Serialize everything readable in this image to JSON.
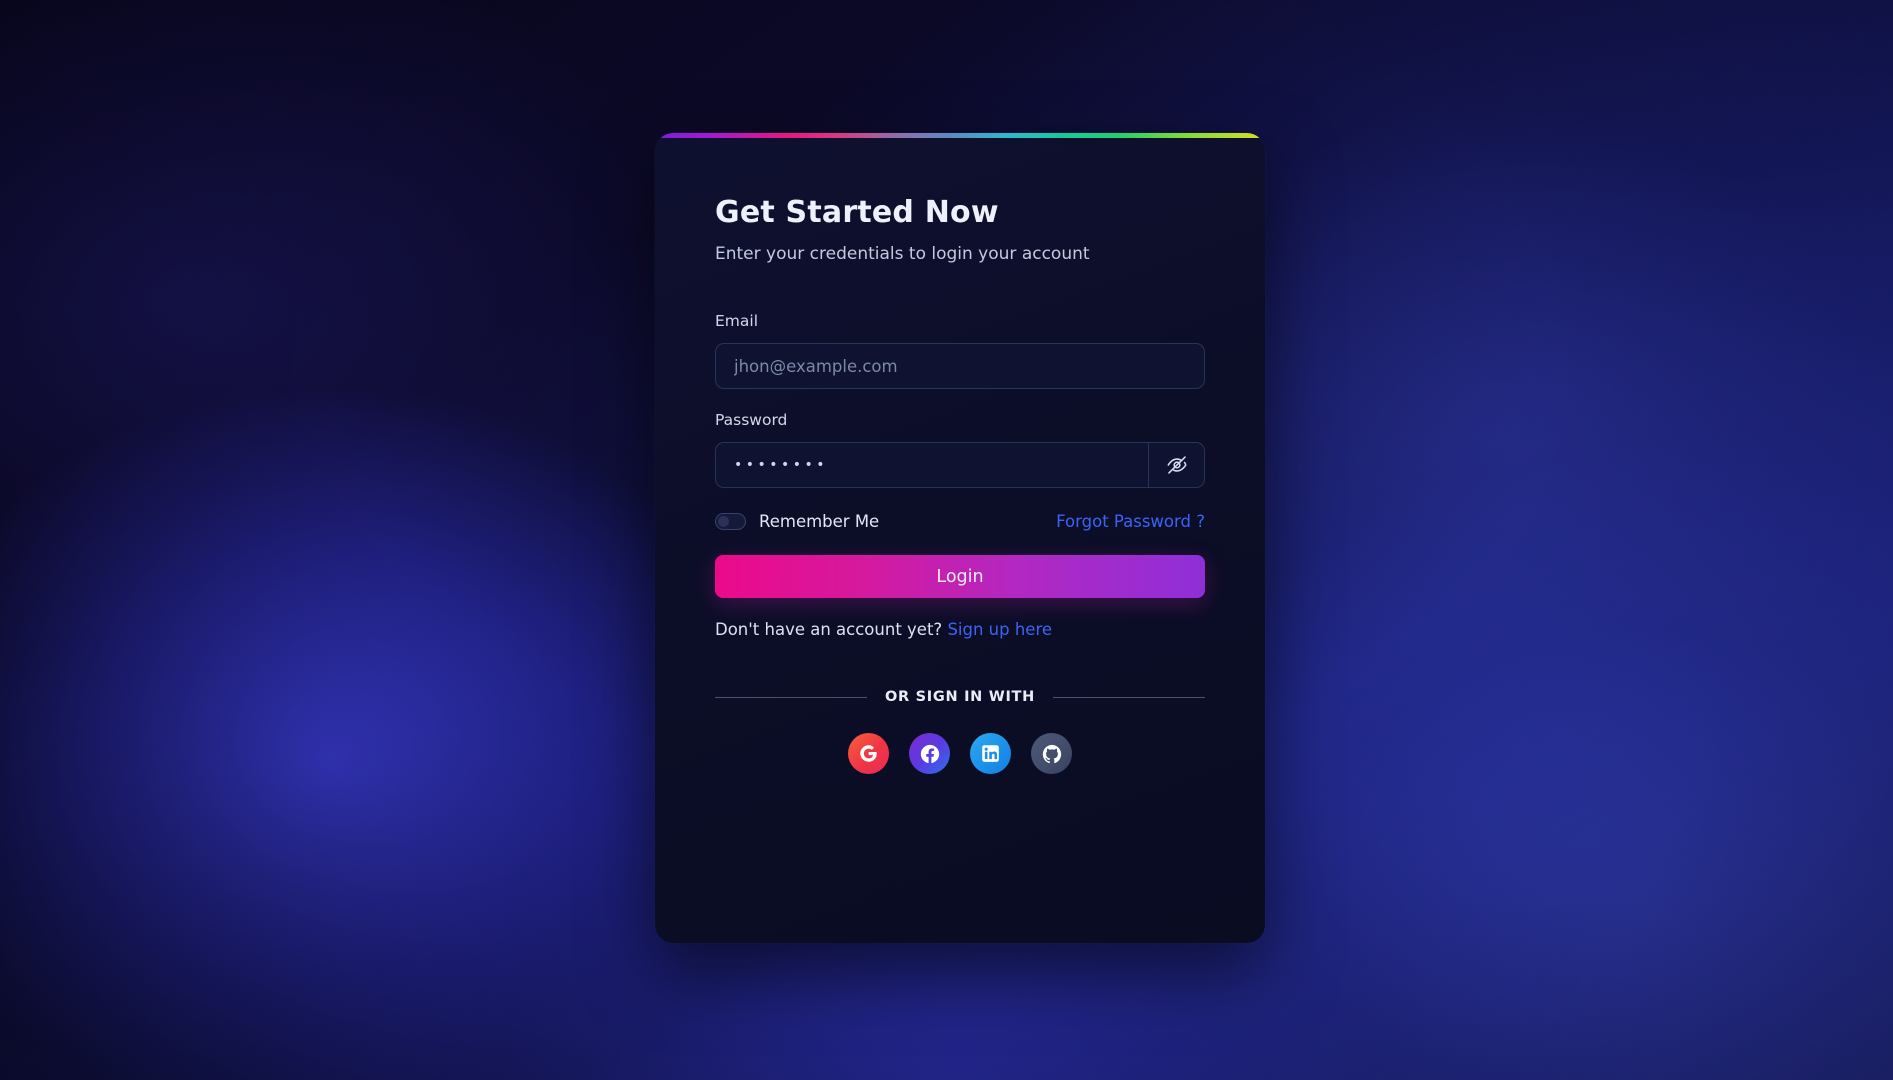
{
  "background": {
    "base_color": "#0a0820",
    "glow_left": "#2a2bb0",
    "glow_right": "#2e3a9e"
  },
  "card": {
    "background_color": "#0c0e28",
    "accent_bar": {
      "name": "rainbow-gradient-bar",
      "stops": [
        "#7b1fd6",
        "#e8177f",
        "#5f87c4",
        "#18c9a0",
        "#7ad93c",
        "#d6e024"
      ]
    },
    "heading": "Get Started Now",
    "subheading": "Enter your credentials to login your account"
  },
  "form": {
    "email": {
      "label": "Email",
      "placeholder": "jhon@example.com",
      "value": ""
    },
    "password": {
      "label": "Password",
      "value": "••••••••",
      "masked_char_count": 8,
      "toggle_icon": "eye-off-icon",
      "visible": false
    },
    "remember": {
      "label": "Remember Me",
      "checked": false
    },
    "forgot_link": "Forgot Password ?",
    "submit_label": "Login",
    "submit_colors": {
      "from": "#ec0a8a",
      "to": "#8f2fd8"
    },
    "link_color": "#3b64f5"
  },
  "signup": {
    "prompt": "Don't have an account yet?",
    "link": "Sign up here"
  },
  "divider": {
    "text": "OR SIGN IN WITH"
  },
  "social": {
    "providers": [
      {
        "name": "google",
        "label": "Google",
        "icon": "google-icon",
        "color": "#f03545"
      },
      {
        "name": "facebook",
        "label": "Facebook",
        "icon": "facebook-icon",
        "color": "#5a3ae0"
      },
      {
        "name": "linkedin",
        "label": "LinkedIn",
        "icon": "linkedin-icon",
        "color": "#1a8fe8"
      },
      {
        "name": "github",
        "label": "GitHub",
        "icon": "github-icon",
        "color": "#424c6b"
      }
    ]
  }
}
